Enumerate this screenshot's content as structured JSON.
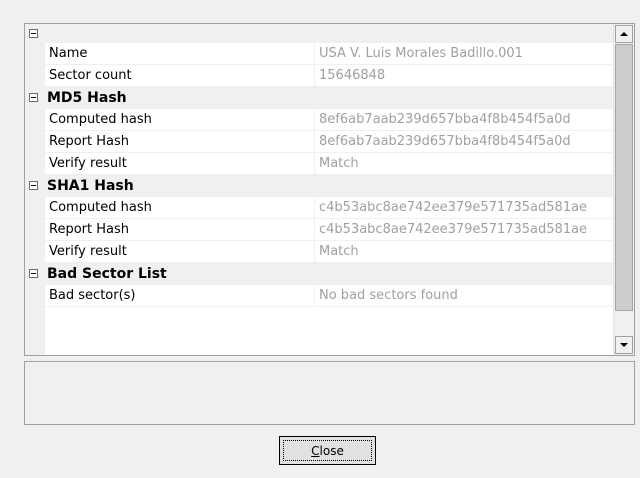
{
  "grid": {
    "rows": [
      {
        "kind": "top",
        "name": "",
        "value": ""
      },
      {
        "kind": "prop",
        "name": "Name",
        "value": "USA V. Luis Morales Badillo.001"
      },
      {
        "kind": "prop",
        "name": "Sector count",
        "value": "15646848"
      },
      {
        "kind": "category",
        "name": "MD5 Hash",
        "value": ""
      },
      {
        "kind": "prop",
        "name": "Computed hash",
        "value": "8ef6ab7aab239d657bba4f8b454f5a0d"
      },
      {
        "kind": "prop",
        "name": "Report Hash",
        "value": "8ef6ab7aab239d657bba4f8b454f5a0d"
      },
      {
        "kind": "prop",
        "name": "Verify result",
        "value": "Match"
      },
      {
        "kind": "category",
        "name": "SHA1 Hash",
        "value": ""
      },
      {
        "kind": "prop",
        "name": "Computed hash",
        "value": "c4b53abc8ae742ee379e571735ad581ae"
      },
      {
        "kind": "prop",
        "name": "Report Hash",
        "value": "c4b53abc8ae742ee379e571735ad581ae"
      },
      {
        "kind": "prop",
        "name": "Verify result",
        "value": "Match"
      },
      {
        "kind": "category",
        "name": "Bad Sector List",
        "value": ""
      },
      {
        "kind": "prop",
        "name": "Bad sector(s)",
        "value": "No bad sectors found"
      }
    ]
  },
  "icons": {
    "expander": "collapse-minus-icon",
    "scroll_up": "scroll-up-arrow-icon",
    "scroll_down": "scroll-down-arrow-icon"
  },
  "close_button": {
    "label_accel": "C",
    "label_rest": "lose"
  }
}
